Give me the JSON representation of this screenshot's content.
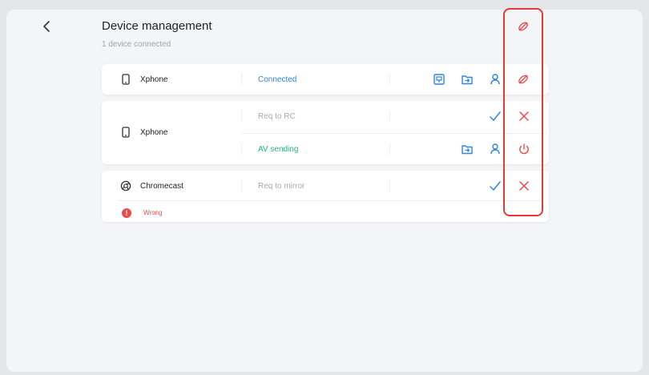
{
  "header": {
    "title": "Device management",
    "subtitle": "1 device connected",
    "back_icon": "chevron-left-icon"
  },
  "devices": [
    {
      "name": "Xphone",
      "type_icon": "phone-icon",
      "rows": [
        {
          "status": "Connected",
          "status_color": "#2f84e0",
          "actions": [
            "screen-share-icon",
            "file-transfer-icon",
            "user-badge-icon",
            "disconnect-icon"
          ]
        }
      ]
    },
    {
      "name": "Xphone",
      "type_icon": "phone-icon",
      "rows": [
        {
          "status": "Req to RC",
          "status_color": "#a6aab0",
          "actions": [
            "accept-check-icon",
            "reject-x-icon"
          ]
        },
        {
          "status": "AV sending",
          "status_color": "#24b37e",
          "actions": [
            "file-transfer-icon",
            "user-badge-icon",
            "power-icon"
          ]
        }
      ]
    },
    {
      "name": "Chromecast",
      "type_icon": "chromecast-icon",
      "rows": [
        {
          "status": "Req to mirror",
          "status_color": "#a6aab0",
          "actions": [
            "accept-check-icon",
            "reject-x-icon"
          ]
        }
      ],
      "error": "Wrong"
    }
  ],
  "colors": {
    "accent_blue": "#2f84e0",
    "success_green": "#24b37e",
    "danger_red": "#ea4b4b",
    "highlight_red": "#e53935"
  }
}
